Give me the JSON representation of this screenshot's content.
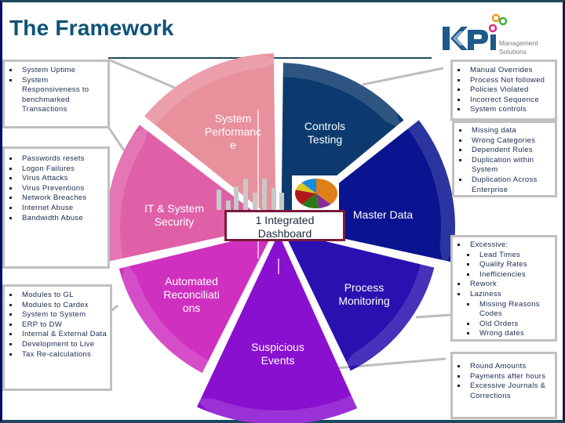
{
  "header": {
    "title": "The Framework"
  },
  "logo": {
    "brand": "KPi",
    "line1": "Management",
    "line2": "Solutions",
    "dot_colors": [
      "#e8a020",
      "#40b040",
      "#e0307a"
    ],
    "brand_color": "#1e5a8a"
  },
  "center": {
    "label": "1 Integrated Dashboard",
    "line1": "1 Integrated",
    "line2": "Dashboard"
  },
  "segments": [
    {
      "id": "system-performance",
      "lines": [
        "System",
        "Performanc",
        "e"
      ],
      "color": "#e8909c"
    },
    {
      "id": "controls-testing",
      "lines": [
        "Controls",
        "Testing"
      ],
      "color": "#0c3a6e"
    },
    {
      "id": "master-data",
      "lines": [
        "Master Data"
      ],
      "color": "#0a1490"
    },
    {
      "id": "process-monitoring",
      "lines": [
        "Process",
        "Monitoring"
      ],
      "color": "#2a10b0"
    },
    {
      "id": "suspicious-events",
      "lines": [
        "Suspicious",
        "Events"
      ],
      "color": "#8a10d0"
    },
    {
      "id": "automated-reconciliations",
      "lines": [
        "Automated",
        "Reconciliati",
        "ons"
      ],
      "color": "#d030c0"
    },
    {
      "id": "it-system-security",
      "lines": [
        "IT & System",
        "Security"
      ],
      "color": "#e060a8"
    }
  ],
  "panels": {
    "system_performance": {
      "items": [
        {
          "text": "System Uptime",
          "level": 1
        },
        {
          "text": "System Responsiveness to benchmarked Transactions",
          "level": 1
        }
      ]
    },
    "it_security": {
      "items": [
        {
          "text": "Passwords resets",
          "level": 1
        },
        {
          "text": "Logon Failures",
          "level": 1
        },
        {
          "text": "Virus Attacks",
          "level": 1
        },
        {
          "text": "Virus Preventions",
          "level": 1
        },
        {
          "text": "Network Breaches",
          "level": 1
        },
        {
          "text": "Internet Abuse",
          "level": 1
        },
        {
          "text": "Bandwidth Abuse",
          "level": 1
        }
      ]
    },
    "reconciliations": {
      "items": [
        {
          "text": "Modules to GL",
          "level": 1
        },
        {
          "text": "Modules to Cardex",
          "level": 1
        },
        {
          "text": "System to System",
          "level": 1
        },
        {
          "text": "ERP to DW",
          "level": 1
        },
        {
          "text": "Internal & External Data",
          "level": 1
        },
        {
          "text": "Development to Live",
          "level": 1
        },
        {
          "text": "Tax Re-calculations",
          "level": 1
        }
      ]
    },
    "controls_testing": {
      "items": [
        {
          "text": "Manual Overrides",
          "level": 1
        },
        {
          "text": "Process Not followed",
          "level": 1
        },
        {
          "text": "Policies  Violated",
          "level": 1
        },
        {
          "text": "Incorrect Sequence",
          "level": 1
        },
        {
          "text": "System controls",
          "level": 1
        }
      ]
    },
    "master_data": {
      "items": [
        {
          "text": "Missing data",
          "level": 1
        },
        {
          "text": "Wrong Categories",
          "level": 1
        },
        {
          "text": "Dependent Rules",
          "level": 1
        },
        {
          "text": "Duplication within System",
          "level": 1
        },
        {
          "text": "Duplication Across Enterprise",
          "level": 1
        }
      ]
    },
    "process_monitoring": {
      "items": [
        {
          "text": "Excessive:",
          "level": 1
        },
        {
          "text": "Lead Times",
          "level": 2
        },
        {
          "text": "Quality Rates",
          "level": 2
        },
        {
          "text": "Inefficiencies",
          "level": 2
        },
        {
          "text": "Rework",
          "level": 1
        },
        {
          "text": "Laziness",
          "level": 1
        },
        {
          "text": "Missing Reasons Codes",
          "level": 2
        },
        {
          "text": "Old Orders",
          "level": 2
        },
        {
          "text": "Wrong dates",
          "level": 2
        }
      ]
    },
    "suspicious_events": {
      "items": [
        {
          "text": "Round Amounts",
          "level": 1
        },
        {
          "text": "Payments after hours",
          "level": 1
        },
        {
          "text": "Excessive Journals & Corrections",
          "level": 1
        }
      ]
    }
  },
  "dashboard_icons": {
    "bar_icon": "bar-chart-icon",
    "pie_icon": "pie-chart-icon",
    "pie_colors": [
      "#e08018",
      "#8a2a9a",
      "#2a7a1a",
      "#b01818",
      "#d8c820",
      "#1a8ae0"
    ]
  }
}
